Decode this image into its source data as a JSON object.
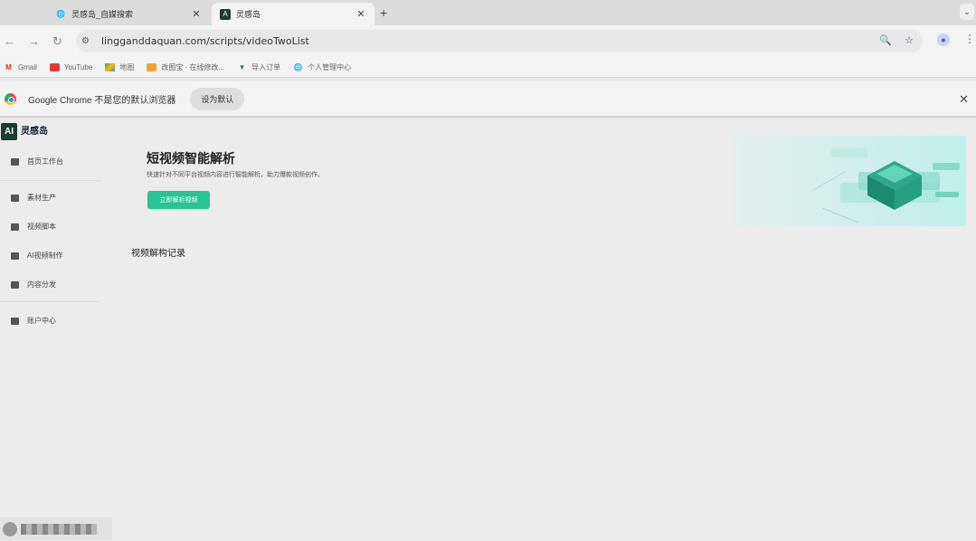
{
  "browser": {
    "tabs": [
      {
        "title": "灵感岛_自媒搜索",
        "active": false,
        "favicon": "globe-icon"
      },
      {
        "title": "灵感岛",
        "active": true,
        "favicon": "ai-logo-icon"
      }
    ],
    "url": "lingganddaquan.com/scripts/videoTwoList",
    "bookmarks": [
      {
        "label": "Gmail",
        "icon": "gmail-icon"
      },
      {
        "label": "YouTube",
        "icon": "youtube-icon"
      },
      {
        "label": "地图",
        "icon": "maps-icon"
      },
      {
        "label": "改图宝 - 在线修改...",
        "icon": "folder-icon"
      },
      {
        "label": "导入订单",
        "icon": "import-icon"
      },
      {
        "label": "个人管理中心",
        "icon": "globe-icon"
      }
    ],
    "infobar": {
      "message": "Google Chrome 不是您的默认浏览器",
      "button": "设为默认"
    }
  },
  "app": {
    "brand": "灵感岛",
    "logo_mark": "AI",
    "nav": [
      {
        "label": "首页工作台",
        "icon": "home-icon"
      },
      {
        "label": "素材生产",
        "icon": "folder-icon"
      },
      {
        "label": "视频脚本",
        "icon": "video-icon"
      },
      {
        "label": "AI视频制作",
        "icon": "ai-video-icon"
      },
      {
        "label": "内容分发",
        "icon": "distribute-icon"
      },
      {
        "label": "账户中心",
        "icon": "account-icon"
      }
    ],
    "hero": {
      "title": "短视频智能解析",
      "subtitle": "快速针对不同平台视频内容进行智能解析，助力爆款视频创作。",
      "button": "立即解析视频"
    },
    "section_title": "视频解构记录"
  },
  "colors": {
    "accent": "#25c596",
    "logo_bg": "#1c3b32"
  }
}
